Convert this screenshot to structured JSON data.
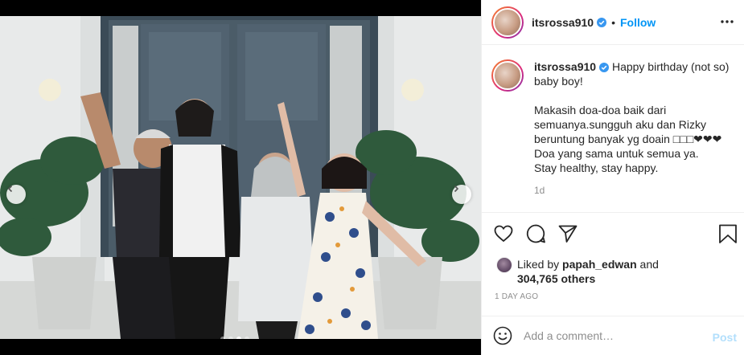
{
  "post": {
    "username": "itsrossa910",
    "separator": "•",
    "follow_label": "Follow",
    "more_icon": "more-horizontal-icon",
    "verified_color": "#3897f0",
    "caption": {
      "first_line": "Happy birthday (not so) baby boy!",
      "lines": [
        "Makasih doa-doa baik dari",
        "semuanya.sungguh aku dan Rizky",
        "beruntung banyak yg doain □□□❤❤❤",
        "Doa yang sama untuk semua ya.",
        "Stay healthy, stay happy."
      ],
      "age": "1d"
    },
    "likes": {
      "prefix": "Liked by",
      "user": "papah_edwan",
      "joiner": "and",
      "count_text": "304,765 others"
    },
    "date": "1 DAY AGO",
    "comment": {
      "placeholder": "Add a comment…",
      "post_label": "Post"
    }
  },
  "carousel": {
    "slide_count": 4,
    "active_index": 2
  },
  "colors": {
    "accent": "#0095f6",
    "post_disabled": "#b2dffc",
    "muted": "#8e8e8e"
  }
}
